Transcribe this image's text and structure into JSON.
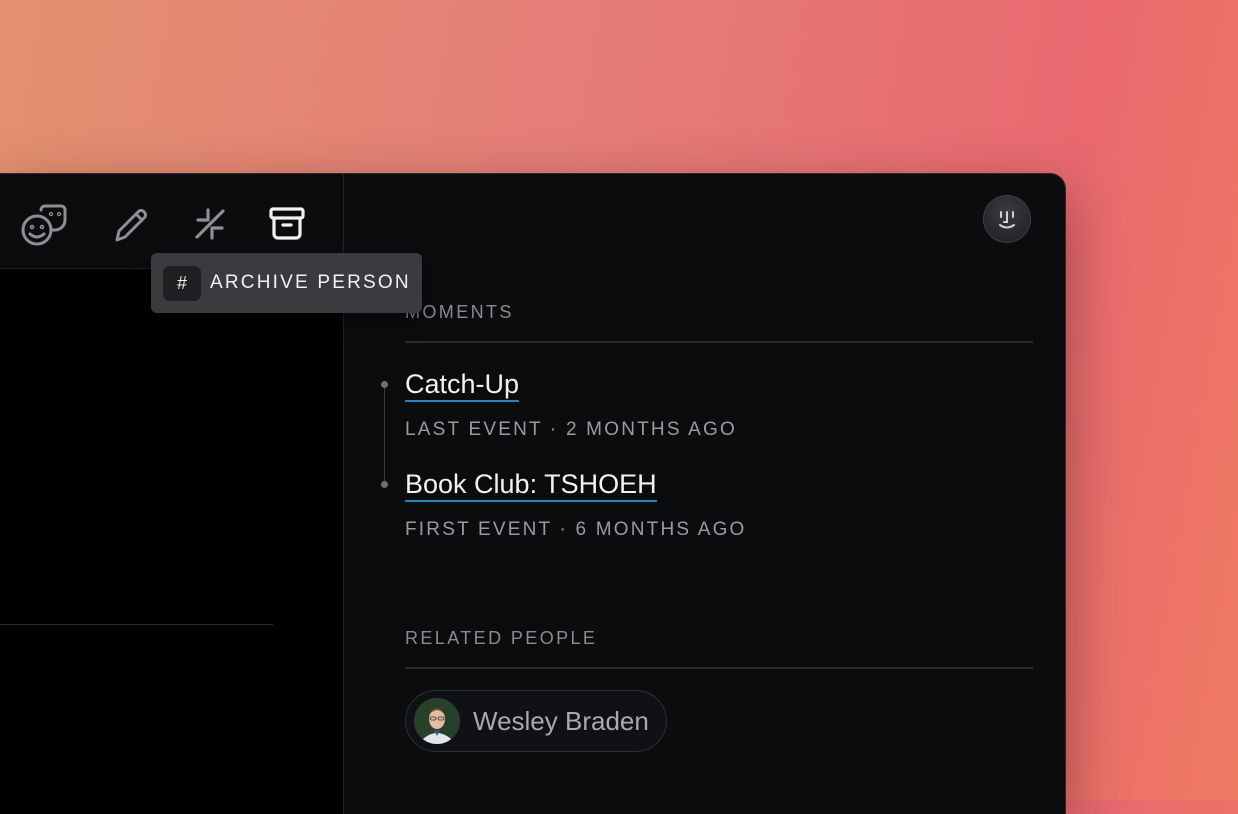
{
  "tooltip": {
    "shortcut": "#",
    "label": "ARCHIVE PERSON"
  },
  "toolbar": {
    "icons": [
      "faces-icon",
      "pencil-icon",
      "minimize-icon",
      "archive-icon"
    ]
  },
  "moments": {
    "title": "MOMENTS",
    "items": [
      {
        "title": "Catch-Up",
        "meta": "LAST EVENT · 2 MONTHS AGO"
      },
      {
        "title": "Book Club: TSHOEH",
        "meta": "FIRST EVENT · 6 MONTHS AGO"
      }
    ]
  },
  "related": {
    "title": "RELATED PEOPLE",
    "people": [
      {
        "name": "Wesley Braden"
      }
    ]
  },
  "colors": {
    "accent_underline": "#2f7fb8",
    "window_bg": "#0b0c0e"
  }
}
